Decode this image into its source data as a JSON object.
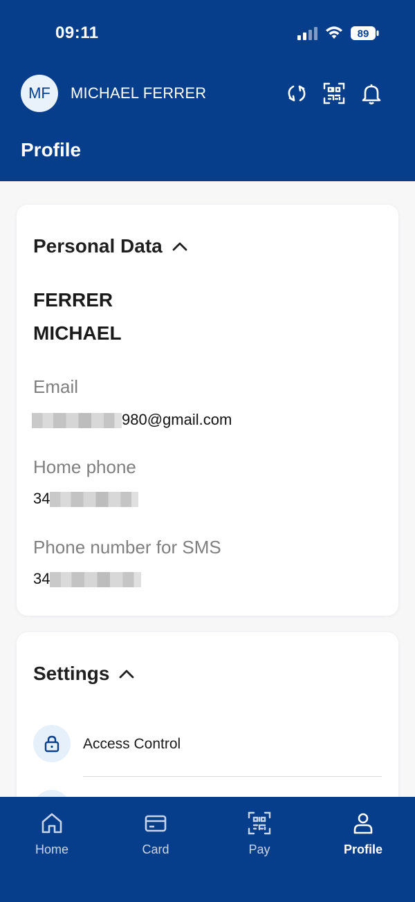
{
  "status_bar": {
    "time": "09:11",
    "battery": "89"
  },
  "header": {
    "avatar_initials": "MF",
    "user_name": "MICHAEL FERRER",
    "icons": [
      "sync-icon",
      "qr-code-icon",
      "bell-icon"
    ],
    "page_title": "Profile"
  },
  "personal_data": {
    "title": "Personal Data",
    "surname": "FERRER",
    "first_name": "MICHAEL",
    "email": {
      "label": "Email",
      "visible_suffix": "980@gmail.com"
    },
    "home_phone": {
      "label": "Home phone",
      "visible_prefix": "34"
    },
    "sms_phone": {
      "label": "Phone number for SMS",
      "visible_prefix": "34"
    }
  },
  "settings": {
    "title": "Settings",
    "items": [
      {
        "label": "Access Control",
        "icon": "lock-icon"
      }
    ]
  },
  "bottom_nav": {
    "items": [
      {
        "label": "Home",
        "icon": "home-icon"
      },
      {
        "label": "Card",
        "icon": "card-icon"
      },
      {
        "label": "Pay",
        "icon": "qr-pay-icon"
      },
      {
        "label": "Profile",
        "icon": "person-icon",
        "active": true
      }
    ]
  },
  "colors": {
    "primary": "#063e8c",
    "accent_light": "#e6f0fb"
  }
}
